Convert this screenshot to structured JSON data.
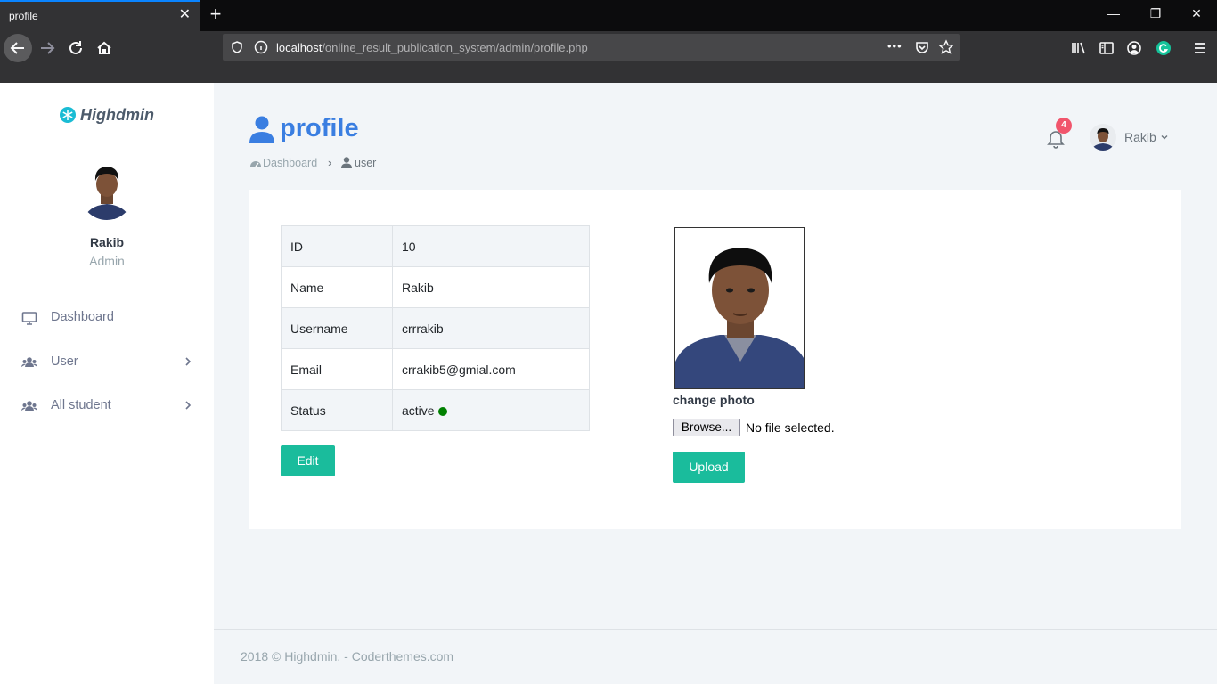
{
  "browser": {
    "tab_title": "profile",
    "tab_close": "✕",
    "new_tab": "+",
    "window_controls": [
      "—",
      "❐",
      "✕"
    ],
    "url_host": "localhost",
    "url_path": "/online_result_publication_system/admin/profile.php",
    "url_more": "•••",
    "accent": "#0a84ff"
  },
  "sidebar": {
    "brand": "Highdmin",
    "user_name": "Rakib",
    "user_role": "Admin",
    "menu": [
      {
        "label": "Dashboard",
        "icon": "monitor-icon",
        "has_arrow": false
      },
      {
        "label": "User",
        "icon": "users-icon",
        "has_arrow": true
      },
      {
        "label": "All student",
        "icon": "users-icon",
        "has_arrow": true
      }
    ]
  },
  "header": {
    "title": "profile",
    "breadcrumb": {
      "home": "Dashboard",
      "separator": "›",
      "current": "user"
    },
    "notification_count": "4",
    "user_name": "Rakib"
  },
  "profile": {
    "rows": [
      {
        "key": "ID",
        "value": "10"
      },
      {
        "key": "Name",
        "value": "Rakib"
      },
      {
        "key": "Username",
        "value": "crrrakib"
      },
      {
        "key": "Email",
        "value": "crrakib5@gmial.com"
      },
      {
        "key": "Status",
        "value": "active"
      }
    ],
    "status_color": "#008000",
    "edit_label": "Edit",
    "change_photo_label": "change photo",
    "browse_label": "Browse...",
    "file_status": "No file selected.",
    "upload_label": "Upload",
    "button_color": "#1abc9c"
  },
  "footer": {
    "text": "2018 © Highdmin. - Coderthemes.com"
  }
}
